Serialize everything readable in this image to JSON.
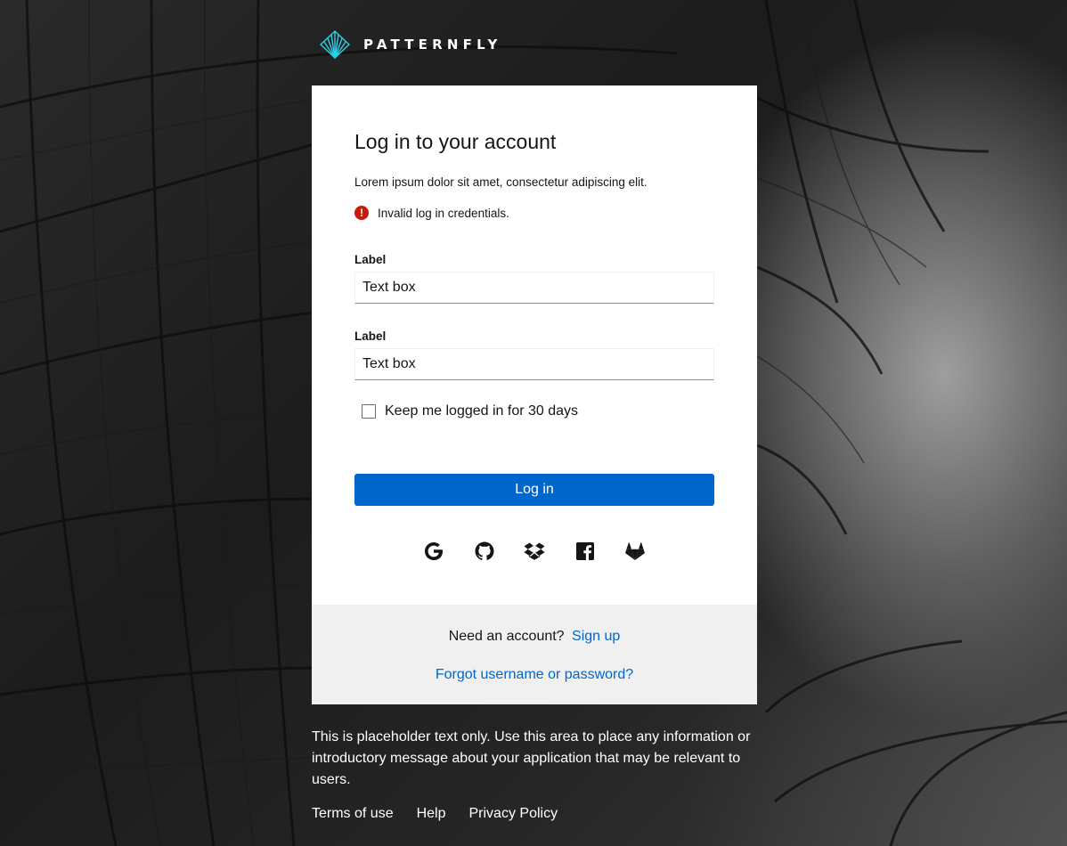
{
  "brand": {
    "name": "PATTERNFLY",
    "accent": "#2bd0e8"
  },
  "login": {
    "title": "Log in to your account",
    "subtitle": "Lorem ipsum dolor sit amet, consectetur adipiscing elit.",
    "error": "Invalid log in credentials.",
    "error_color": "#c9190b",
    "username_label": "Label",
    "username_value": "Text box",
    "password_label": "Label",
    "password_value": "Text box",
    "remember_label": "Keep me logged in for 30 days",
    "remember_checked": false,
    "submit_label": "Log in",
    "primary_color": "#0066cc",
    "social_icons": [
      "google-icon",
      "github-icon",
      "dropbox-icon",
      "facebook-icon",
      "gitlab-icon"
    ]
  },
  "footer": {
    "need_account": "Need an account?",
    "signup_link": "Sign up",
    "forgot_link": "Forgot username or password?"
  },
  "info": {
    "text": "This is placeholder text only. Use this area to place any information or introductory message about your application that may be relevant to users.",
    "links": [
      "Terms of use",
      "Help",
      "Privacy Policy"
    ]
  }
}
